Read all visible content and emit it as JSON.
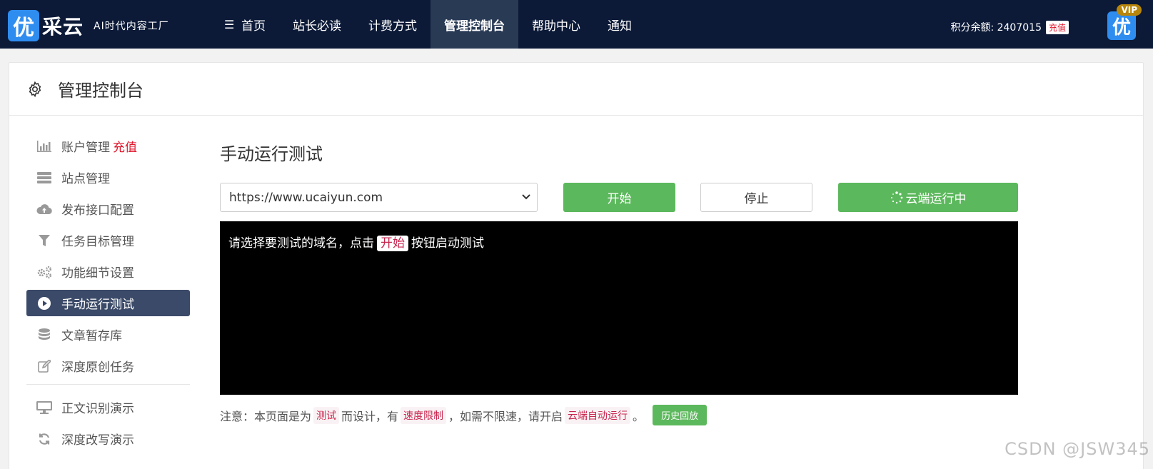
{
  "brand": {
    "logo_glyph": "优",
    "name": "采云",
    "slogan": "AI时代内容工厂"
  },
  "nav": {
    "items": [
      {
        "label": "首页",
        "icon": "menu-list-icon"
      },
      {
        "label": "站长必读"
      },
      {
        "label": "计费方式"
      },
      {
        "label": "管理控制台",
        "active": true
      },
      {
        "label": "帮助中心"
      },
      {
        "label": "通知"
      }
    ],
    "menu_glyph": "☰"
  },
  "account": {
    "balance_label": "积分余额: 2407015",
    "recharge": "充值",
    "avatar_glyph": "优",
    "vip": "VIP"
  },
  "page": {
    "title": "管理控制台",
    "icon": "gear-icon"
  },
  "sidebar": {
    "items": [
      {
        "label": "账户管理",
        "extra": "充值",
        "icon": "bar-chart-icon"
      },
      {
        "label": "站点管理",
        "icon": "server-icon"
      },
      {
        "label": "发布接口配置",
        "icon": "cloud-upload-icon"
      },
      {
        "label": "任务目标管理",
        "icon": "filter-icon"
      },
      {
        "label": "功能细节设置",
        "icon": "gears-icon"
      },
      {
        "label": "手动运行测试",
        "icon": "play-circle-icon",
        "active": true
      },
      {
        "label": "文章暂存库",
        "icon": "database-icon"
      },
      {
        "label": "深度原创任务",
        "icon": "edit-icon"
      }
    ],
    "items2": [
      {
        "label": "正文识别演示",
        "icon": "monitor-icon"
      },
      {
        "label": "深度改写演示",
        "icon": "refresh-icon"
      }
    ]
  },
  "content": {
    "title": "手动运行测试",
    "select_value": "https://www.ucaiyun.com",
    "start": "开始",
    "stop": "停止",
    "cloud": "云端运行中",
    "console_before": "请选择要测试的域名，点击",
    "console_hl": "开始",
    "console_after": "按钮启动测试",
    "note_1": "注意：本页面是为",
    "note_code_1": "测试",
    "note_2": "而设计，有",
    "note_code_2": "速度限制",
    "note_3": "，如需不限速，请开启",
    "note_code_3": "云端自动运行",
    "note_4": "。",
    "history": "历史回放"
  },
  "watermark": "CSDN @JSW345",
  "colors": {
    "topbar": "#0c1a38",
    "accent_green": "#5cb85c",
    "active_side": "#3b4a68",
    "red": "#e0162b"
  }
}
